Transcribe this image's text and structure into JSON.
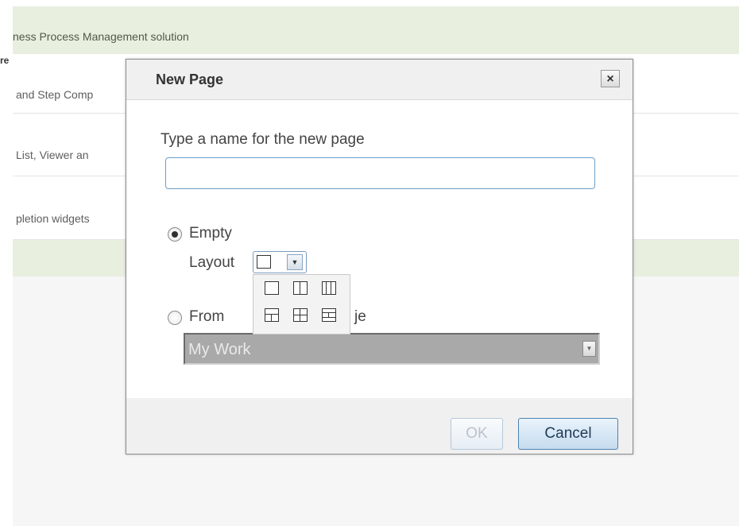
{
  "background": {
    "header_text": "ness Process Management solution",
    "cut_text": "re",
    "rows": [
      {
        "text": "and Step Comp"
      },
      {
        "text": "List, Viewer an"
      },
      {
        "text": "pletion widgets"
      }
    ]
  },
  "dialog": {
    "title": "New Page",
    "close_label": "×",
    "prompt": "Type a name for the new page",
    "name_value": "",
    "options": {
      "empty_label": "Empty",
      "empty_selected": true,
      "layout_label": "Layout",
      "from_existing_label_visible_start": "From",
      "from_existing_label_visible_end": "je",
      "from_existing_selected": false,
      "existing_page_value": "My Work"
    },
    "layout_options": [
      "one-column",
      "two-column",
      "three-column",
      "header-two-column",
      "two-by-two",
      "header-three-row"
    ],
    "buttons": {
      "ok": "OK",
      "cancel": "Cancel"
    }
  }
}
